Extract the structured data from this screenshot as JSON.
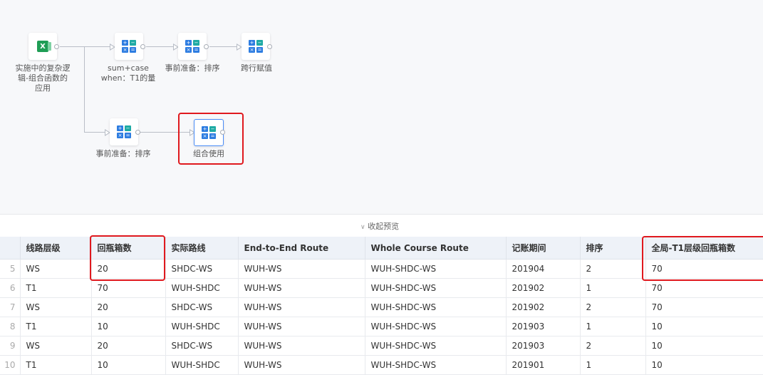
{
  "flow": {
    "source": {
      "label": "实施中的复杂逻\n辑-组合函数的\n应用",
      "icon": "excel-icon"
    },
    "nodes": [
      {
        "label": "sum+case\nwhen：T1的量",
        "icon": "calculator-icon"
      },
      {
        "label": "事前准备：排序",
        "icon": "calculator-icon"
      },
      {
        "label": "跨行赋值",
        "icon": "calculator-icon"
      },
      {
        "label": "事前准备：排序",
        "icon": "calculator-icon"
      },
      {
        "label": "组合使用",
        "icon": "calculator-icon"
      }
    ]
  },
  "preview": {
    "toggle_label": "收起预览",
    "columns": [
      "",
      "线路层级",
      "回瓶箱数",
      "实际路线",
      "End-to-End Route",
      "Whole Course Route",
      "记账期间",
      "排序",
      "全局-T1层级回瓶箱数"
    ],
    "rows": [
      [
        "5",
        "WS",
        "20",
        "SHDC-WS",
        "WUH-WS",
        "WUH-SHDC-WS",
        "201904",
        "2",
        "70"
      ],
      [
        "6",
        "T1",
        "70",
        "WUH-SHDC",
        "WUH-WS",
        "WUH-SHDC-WS",
        "201902",
        "1",
        "70"
      ],
      [
        "7",
        "WS",
        "20",
        "SHDC-WS",
        "WUH-WS",
        "WUH-SHDC-WS",
        "201902",
        "2",
        "70"
      ],
      [
        "8",
        "T1",
        "10",
        "WUH-SHDC",
        "WUH-WS",
        "WUH-SHDC-WS",
        "201903",
        "1",
        "10"
      ],
      [
        "9",
        "WS",
        "20",
        "SHDC-WS",
        "WUH-WS",
        "WUH-SHDC-WS",
        "201903",
        "2",
        "10"
      ],
      [
        "10",
        "T1",
        "10",
        "WUH-SHDC",
        "WUH-WS",
        "WUH-SHDC-WS",
        "201901",
        "1",
        "10"
      ]
    ]
  },
  "colors": {
    "highlight": "#e0191e",
    "selected": "#4b8df8",
    "header_bg": "#eef2f8"
  }
}
